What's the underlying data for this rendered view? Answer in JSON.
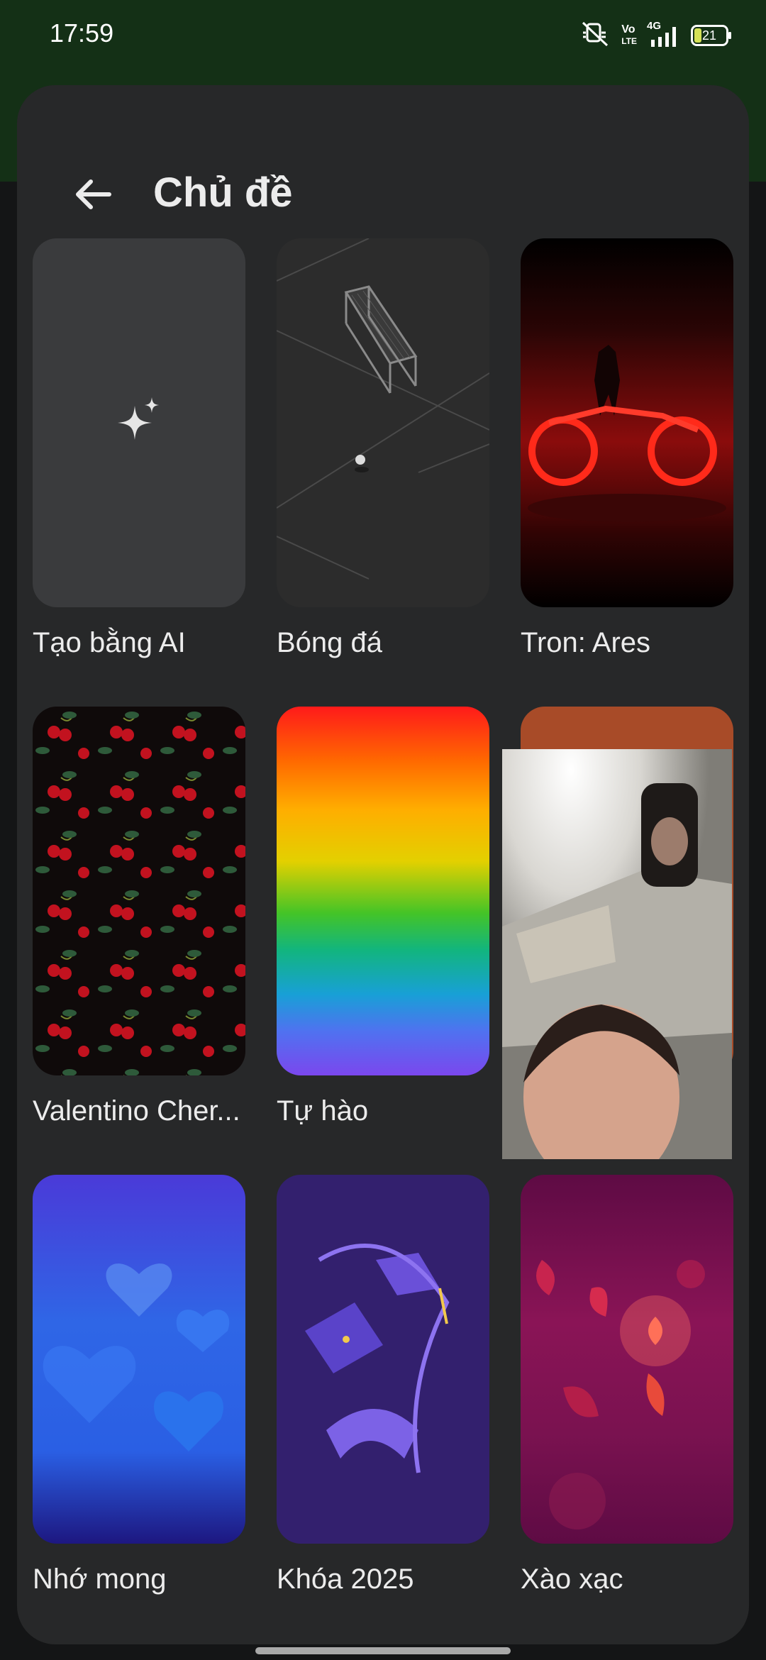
{
  "status_bar": {
    "time": "17:59",
    "network_label": "4G",
    "volte_top": "Vo",
    "volte_bottom": "LTE",
    "battery_level": "21",
    "icons": [
      "silent-icon",
      "volte-icon",
      "signal-4g-icon",
      "battery-icon"
    ]
  },
  "header": {
    "title": "Chủ đề",
    "back_icon": "arrow-left-icon"
  },
  "themes": [
    {
      "label": "Tạo bằng AI",
      "icon": "sparkle-icon"
    },
    {
      "label": "Bóng đá"
    },
    {
      "label": "Tron: Ares"
    },
    {
      "label": "Valentino Cher..."
    },
    {
      "label": "Tự hào"
    },
    {
      "label": ""
    },
    {
      "label": "Nhớ mong"
    },
    {
      "label": "Khóa 2025"
    },
    {
      "label": "Xào xạc"
    }
  ],
  "colors": {
    "top_bar": "#143016",
    "sheet": "#272829",
    "text": "#ececec"
  }
}
